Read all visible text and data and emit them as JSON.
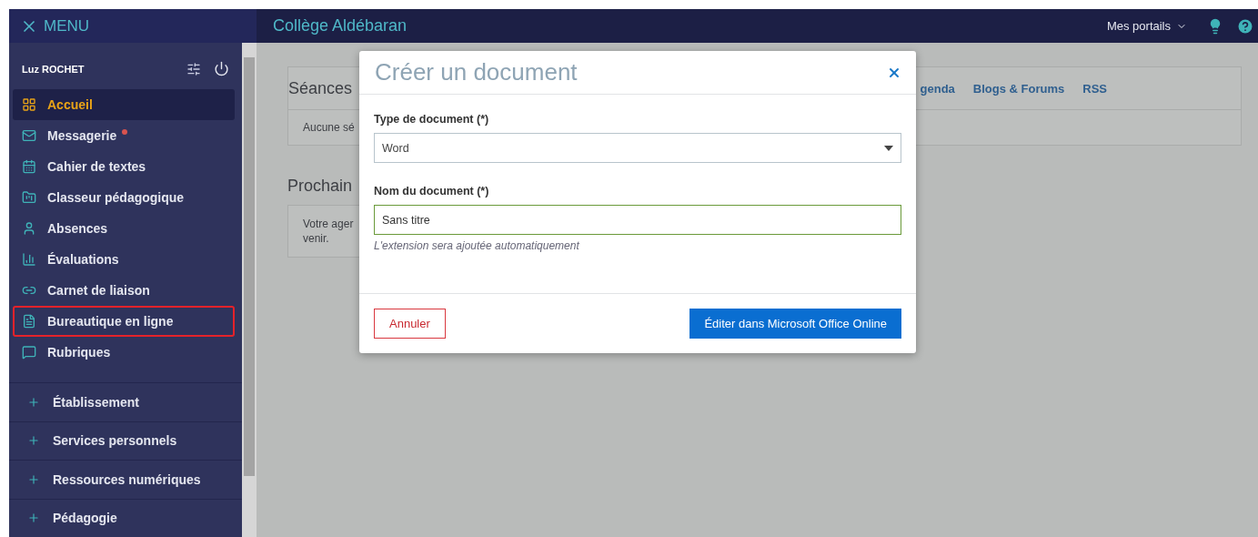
{
  "header": {
    "menu_label": "MENU",
    "site_title": "Collège Aldébaran",
    "portals": "Mes portails"
  },
  "sidebar": {
    "user": "Luz ROCHET",
    "items": [
      {
        "label": "Accueil",
        "selected": true,
        "unread": false,
        "highlighted": false
      },
      {
        "label": "Messagerie",
        "selected": false,
        "unread": true,
        "highlighted": false
      },
      {
        "label": "Cahier de textes",
        "selected": false,
        "unread": false,
        "highlighted": false
      },
      {
        "label": "Classeur pédagogique",
        "selected": false,
        "unread": false,
        "highlighted": false
      },
      {
        "label": "Absences",
        "selected": false,
        "unread": false,
        "highlighted": false
      },
      {
        "label": "Évaluations",
        "selected": false,
        "unread": false,
        "highlighted": false
      },
      {
        "label": "Carnet de liaison",
        "selected": false,
        "unread": false,
        "highlighted": false
      },
      {
        "label": "Bureautique en ligne",
        "selected": false,
        "unread": false,
        "highlighted": true
      },
      {
        "label": "Rubriques",
        "selected": false,
        "unread": false,
        "highlighted": false
      }
    ],
    "sections": [
      {
        "label": "Établissement",
        "expanded": false
      },
      {
        "label": "Services personnels",
        "expanded": false
      },
      {
        "label": "Ressources numériques",
        "expanded": false
      },
      {
        "label": "Pédagogie",
        "expanded": false
      }
    ]
  },
  "content": {
    "sessions": {
      "title": "Séances",
      "tabs": [
        "genda",
        "Blogs & Forums",
        "RSS"
      ],
      "text": "Aucune sé"
    },
    "next": {
      "title": "Prochain",
      "text_lines": [
        "Votre ager",
        "venir."
      ]
    }
  },
  "dialog": {
    "title": "Créer un document",
    "type_label": "Type de document (*)",
    "type_value": "Word",
    "name_label": "Nom du document (*)",
    "name_value": "Sans titre",
    "hint": "L'extension sera ajoutée automatiquement",
    "cancel": "Annuler",
    "submit": "Éditer dans Microsoft Office Online"
  }
}
